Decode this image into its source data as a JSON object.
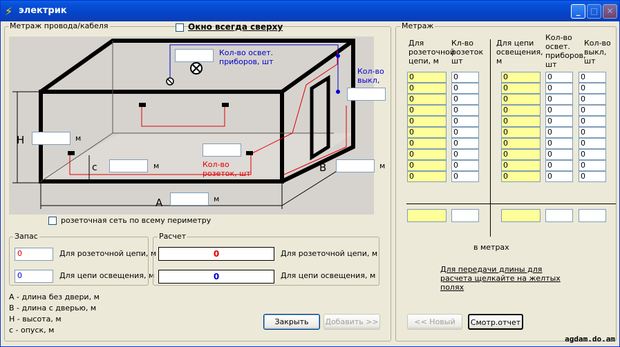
{
  "window": {
    "title": "электрик"
  },
  "always_on_top": {
    "label": "Окно всегда сверху"
  },
  "wire_group": {
    "title": "Метраж провода/кабеля",
    "lights_label": "Кол-во освет. приборов, шт",
    "switches_label": "Кол-во выкл, шт",
    "sockets_label": "Кол-во розеток, шт",
    "unit_m": "м",
    "dim_h": "H",
    "dim_c": "c",
    "dim_a": "A",
    "dim_b": "B",
    "perimeter_label": "розеточная сеть по всему периметру"
  },
  "reserve": {
    "title": "Запас",
    "socket_value": "0",
    "light_value": "0",
    "socket_label": "Для розеточной цепи, м",
    "light_label": "Для цепи освещения, м"
  },
  "calc": {
    "title": "Расчет",
    "socket_value": "0",
    "light_value": "0",
    "socket_label": "Для розеточной цепи, м",
    "light_label": "Для цепи освещения, м"
  },
  "legend": [
    "А - длина без двери, м",
    "В - длина с дверью, м",
    "Н - высота, м",
    "с - опуск, м"
  ],
  "buttons": {
    "close": "Закрыть",
    "add": "Добавить >>",
    "new": "<< Новый",
    "report": "Смотр.отчет"
  },
  "meterage": {
    "title": "Метраж",
    "col1": "Для\nрозеточной\nцепи, м",
    "col2": "Кл-во\nрозеток\nшт",
    "col3": "Для цепи\nосвещения,\nм",
    "col4": "Кол-во\nосвет.\nприборов,\nшт",
    "col5": "Кол-во\nвыкл, шт",
    "rows": [
      "0",
      "0",
      "0",
      "0",
      "0",
      "0",
      "0",
      "0",
      "0",
      "0"
    ],
    "in_meters": "в метрах",
    "hint": "Для передачи длины для расчета щелкайте на желтых полях"
  },
  "watermark": "agdam.do.am",
  "colors": {
    "title_bar": "#0A5FE4",
    "yellow_field": "#FFFF99",
    "socket_wire": "#E00000",
    "light_wire": "#0000CC"
  }
}
